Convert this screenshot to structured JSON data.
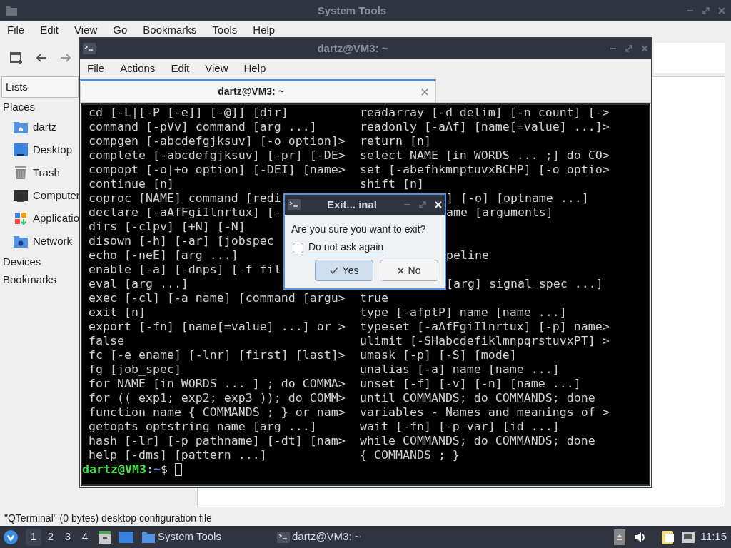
{
  "file_manager": {
    "title": "System Tools",
    "menu": [
      "File",
      "Edit",
      "View",
      "Go",
      "Bookmarks",
      "Tools",
      "Help"
    ],
    "sidebar": {
      "view_selector": "Lists",
      "sections": [
        {
          "label": "Places",
          "items": [
            {
              "label": "dartz",
              "kind": "home"
            },
            {
              "label": "Desktop",
              "kind": "desktop"
            },
            {
              "label": "Trash",
              "kind": "trash"
            },
            {
              "label": "Computer",
              "kind": "computer"
            },
            {
              "label": "Applicatio",
              "kind": "apps"
            },
            {
              "label": "Network",
              "kind": "network"
            }
          ]
        },
        {
          "label": "Devices"
        },
        {
          "label": "Bookmarks"
        }
      ]
    },
    "status": "\"QTerminal\" (0 bytes) desktop configuration file"
  },
  "terminal": {
    "title": "dartz@VM3: ~",
    "menu": [
      "File",
      "Actions",
      "Edit",
      "View",
      "Help"
    ],
    "tab": {
      "label": "dartz@VM3: ~",
      "selected": true
    },
    "lines": [
      {
        "left": "cd [-L|[-P [-e]] [-@]] [dir]",
        "right": "readarray [-d delim] [-n count] [->",
        "right_cut": false
      },
      {
        "left": "command [-pVv] command [arg ...]",
        "right": "readonly [-aAf] [name[=value] ...]>",
        "right_cut": false
      },
      {
        "left": "compgen [-abcdefgjksuv] [-o option]>",
        "right": "return [n]",
        "right_cut": false
      },
      {
        "left": "complete [-abcdefgjksuv] [-pr] [-DE>",
        "right": "select NAME [in WORDS ... ;] do CO>",
        "right_cut": false
      },
      {
        "left": "compopt [-o|+o option] [-DEI] [name>",
        "right": "set [-abefhkmnptuvxBCHP] [-o optio>",
        "right_cut": false
      },
      {
        "left": "continue [n]",
        "right": "shift [n]",
        "right_cut": false
      },
      {
        "left": "coproc [NAME] command [redi",
        "right": "] [-o] [optname ...]",
        "right_cut": true
      },
      {
        "left": "declare [-aAfFgiIlnrtux] [-",
        "right": "ame [arguments]",
        "right_cut": true
      },
      {
        "left": "dirs [-clpv] [+N] [-N]"
      },
      {
        "left": "disown [-h] [-ar] [jobspec"
      },
      {
        "left": "echo [-neE] [arg ...]",
        "right": "peline",
        "right_cut": true
      },
      {
        "left": "enable [-a] [-dnps] [-f fil"
      },
      {
        "left": "eval [arg ...]",
        "right": "[arg] signal_spec ...]",
        "right_cut": true
      },
      {
        "left": "exec [-cl] [-a name] [command [argu>",
        "right": "true",
        "right_cut": false
      },
      {
        "left": "exit [n]",
        "right": "type [-afptP] name [name ...]",
        "right_cut": false
      },
      {
        "left": "export [-fn] [name[=value] ...] or >",
        "right": "typeset [-aAfFgiIlnrtux] [-p] name>",
        "right_cut": false
      },
      {
        "left": "false",
        "right": "ulimit [-SHabcdefiklmnpqrstuvxPT] >",
        "right_cut": false
      },
      {
        "left": "fc [-e ename] [-lnr] [first] [last]>",
        "right": "umask [-p] [-S] [mode]",
        "right_cut": false
      },
      {
        "left": "fg [job_spec]",
        "right": "unalias [-a] name [name ...]",
        "right_cut": false
      },
      {
        "left": "for NAME [in WORDS ... ] ; do COMMA>",
        "right": "unset [-f] [-v] [-n] [name ...]",
        "right_cut": false
      },
      {
        "left": "for (( exp1; exp2; exp3 )); do COMM>",
        "right": "until COMMANDS; do COMMANDS; done",
        "right_cut": false
      },
      {
        "left": "function name { COMMANDS ; } or nam>",
        "right": "variables - Names and meanings of >",
        "right_cut": false
      },
      {
        "left": "getopts optstring name [arg ...]",
        "right": "wait [-fn] [-p var] [id ...]",
        "right_cut": false
      },
      {
        "left": "hash [-lr] [-p pathname] [-dt] [nam>",
        "right": "while COMMANDS; do COMMANDS; done",
        "right_cut": false
      },
      {
        "left": "help [-dms] [pattern ...]",
        "right": "{ COMMANDS ; }",
        "right_cut": false
      }
    ],
    "prompt": {
      "user_host": "dartz@VM3",
      "separator": ":",
      "path": "~",
      "symbol": "$"
    }
  },
  "dialog": {
    "title": "Exit... inal",
    "message": "Are you sure you want to exit?",
    "checkbox": {
      "label": "Do not ask again",
      "checked": false
    },
    "buttons": [
      {
        "label": "Yes",
        "kind": "yes",
        "default": true
      },
      {
        "label": "No",
        "kind": "no",
        "default": false
      }
    ]
  },
  "taskbar": {
    "workspaces": [
      {
        "label": "1",
        "selected": true
      },
      {
        "label": "2",
        "selected": false
      },
      {
        "label": "3",
        "selected": false
      },
      {
        "label": "4",
        "selected": false
      }
    ],
    "tasks": [
      {
        "label": "System Tools",
        "kind": "folder"
      },
      {
        "label": "dartz@VM3: ~",
        "kind": "terminal"
      }
    ],
    "clock": "11:15"
  }
}
